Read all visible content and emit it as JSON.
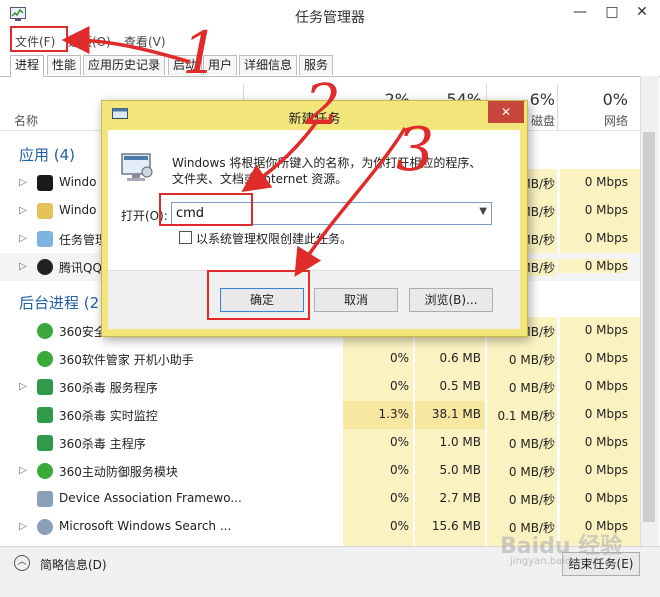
{
  "window": {
    "title": "任务管理器",
    "minimize": "—",
    "maximize": "□",
    "close": "✕"
  },
  "menu": [
    {
      "label": "文件(F)"
    },
    {
      "label": "选项(O)"
    },
    {
      "label": "查看(V)"
    }
  ],
  "tabs": [
    {
      "label": "进程",
      "active": true
    },
    {
      "label": "性能"
    },
    {
      "label": "应用历史记录"
    },
    {
      "label": "启动"
    },
    {
      "label": "用户"
    },
    {
      "label": "详细信息"
    },
    {
      "label": "服务"
    }
  ],
  "columns": {
    "name": "名称",
    "cpu": {
      "pct": "2%",
      "label": "CPU"
    },
    "memory": {
      "pct": "54%",
      "label": "内存"
    },
    "disk": {
      "pct": "6%",
      "label": "磁盘"
    },
    "network": {
      "pct": "0%",
      "label": "网络"
    }
  },
  "groups": {
    "apps": "应用 (4)",
    "background": "后台进程 (2"
  },
  "apps": [
    {
      "name": "Windo",
      "disk": "MB/秒",
      "net": "0 Mbps"
    },
    {
      "name": "Windo",
      "disk": "MB/秒",
      "net": "0 Mbps"
    },
    {
      "name": "任务管理",
      "disk": "MB/秒",
      "net": "0 Mbps"
    },
    {
      "name": "腾讯QQ",
      "disk": "MB/秒",
      "net": "0 Mbps"
    }
  ],
  "processes": [
    {
      "name": "360安全",
      "cpu": "",
      "mem": "",
      "disk": "MB/秒",
      "net": "0 Mbps"
    },
    {
      "name": "360软件管家 开机小助手",
      "cpu": "0%",
      "mem": "0.6 MB",
      "disk": "0 MB/秒",
      "net": "0 Mbps"
    },
    {
      "name": "360杀毒 服务程序",
      "cpu": "0%",
      "mem": "0.5 MB",
      "disk": "0 MB/秒",
      "net": "0 Mbps"
    },
    {
      "name": "360杀毒 实时监控",
      "cpu": "1.3%",
      "mem": "38.1 MB",
      "disk": "0.1 MB/秒",
      "net": "0 Mbps"
    },
    {
      "name": "360杀毒 主程序",
      "cpu": "0%",
      "mem": "1.0 MB",
      "disk": "0 MB/秒",
      "net": "0 Mbps"
    },
    {
      "name": "360主动防御服务模块",
      "cpu": "0%",
      "mem": "5.0 MB",
      "disk": "0 MB/秒",
      "net": "0 Mbps"
    },
    {
      "name": "Device Association Framewo...",
      "cpu": "0%",
      "mem": "2.7 MB",
      "disk": "0 MB/秒",
      "net": "0 Mbps"
    },
    {
      "name": "Microsoft Windows Search ...",
      "cpu": "0%",
      "mem": "15.6 MB",
      "disk": "0 MB/秒",
      "net": "0 Mbps"
    }
  ],
  "bottom": {
    "summary": "简略信息(D)",
    "end_task": "结束任务(E)"
  },
  "dialog": {
    "title": "新建任务",
    "close": "✕",
    "desc_line1": "Windows 将根据你所键入的名称，为你打开相应的程序、",
    "desc_line2": "文件夹、文档或 Internet 资源。",
    "open_label": "打开(O):",
    "open_value": "cmd",
    "admin_checkbox": "以系统管理权限创建此任务。",
    "ok": "确定",
    "cancel": "取消",
    "browse": "浏览(B)..."
  },
  "annotations": {
    "n1": "1",
    "n2": "2",
    "n3": "3"
  },
  "watermark": {
    "brand": "Baidu 经验",
    "url": "jingyan.baidu.com"
  },
  "colors": {
    "highlight": "#fbf2c2",
    "highlight_strong": "#f7e7a3",
    "dialog_frame": "#f2e57a",
    "annotation_red": "#e02b2b",
    "group_blue": "#1e5fa6"
  }
}
